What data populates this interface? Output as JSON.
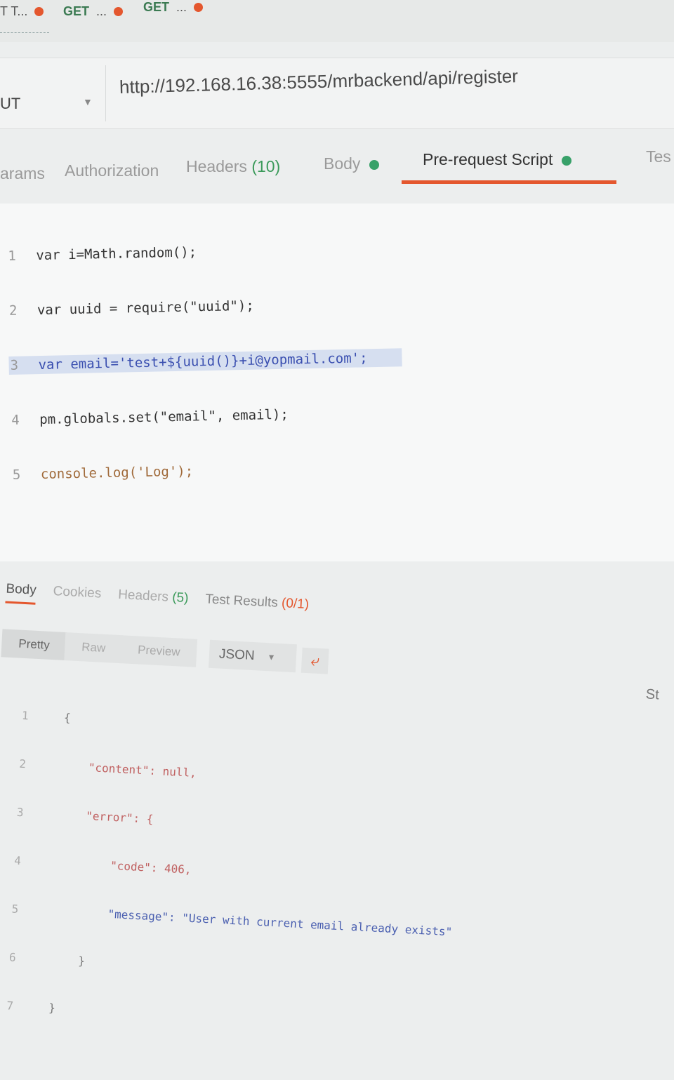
{
  "tabs": [
    {
      "label": "T T...",
      "color": "#e4572e"
    },
    {
      "method": "GET",
      "label": "...",
      "color": "#e4572e"
    },
    {
      "method": "GET",
      "label": "...",
      "color": "#e4572e"
    }
  ],
  "request": {
    "method": "UT",
    "url": "http://192.168.16.38:5555/mrbackend/api/register"
  },
  "request_tabs": {
    "params": "arams",
    "authorization": "Authorization",
    "headers_label": "Headers",
    "headers_count": "(10)",
    "body": "Body",
    "pre_request": "Pre-request Script",
    "tests": "Tes"
  },
  "script_lines": [
    {
      "n": "1",
      "text": "var i=Math.random();"
    },
    {
      "n": "2",
      "text": "var uuid = require(\"uuid\");"
    },
    {
      "n": "3",
      "text": "var email='test+${uuid()}+i@yopmail.com';"
    },
    {
      "n": "4",
      "text": "pm.globals.set(\"email\", email);"
    },
    {
      "n": "5",
      "text": "console.log('Log');"
    }
  ],
  "response_tabs": {
    "body": "Body",
    "cookies": "Cookies",
    "headers_label": "Headers",
    "headers_count": "(5)",
    "tests_label": "Test Results",
    "tests_count": "(0/1)"
  },
  "format_bar": {
    "pretty": "Pretty",
    "raw": "Raw",
    "preview": "Preview",
    "json": "JSON",
    "status": "St"
  },
  "response_lines": [
    {
      "n": "1",
      "text": "{"
    },
    {
      "n": "2",
      "text": "    \"content\": null,"
    },
    {
      "n": "3",
      "text": "    \"error\": {"
    },
    {
      "n": "4",
      "text": "        \"code\": 406,"
    },
    {
      "n": "5",
      "text": "        \"message\": \"User with current email already exists\""
    },
    {
      "n": "6",
      "text": "    }"
    },
    {
      "n": "7",
      "text": "}"
    }
  ]
}
